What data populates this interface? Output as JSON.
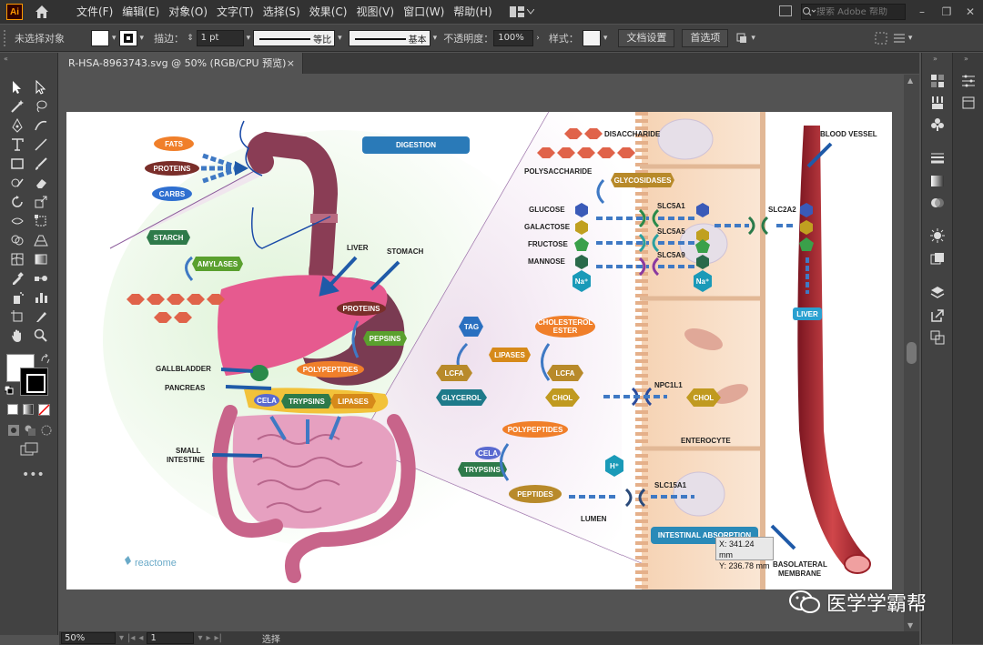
{
  "app": {
    "logo_text": "Ai",
    "menus": [
      "文件(F)",
      "编辑(E)",
      "对象(O)",
      "文字(T)",
      "选择(S)",
      "效果(C)",
      "视图(V)",
      "窗口(W)",
      "帮助(H)"
    ],
    "search_placeholder": "搜索 Adobe 帮助"
  },
  "controlbar": {
    "selection_label": "未选择对象",
    "stroke_label": "描边：",
    "stroke_weight": "1 pt",
    "stroke_profile": "等比",
    "brush": "基本",
    "opacity_label": "不透明度：",
    "opacity_value": "100%",
    "style_label": "样式：",
    "doc_setup_button": "文档设置",
    "prefs_button": "首选项"
  },
  "document": {
    "tab_title": "R-HSA-8963743.svg @ 50% (RGB/CPU 预览)",
    "close_glyph": "×"
  },
  "statusbar": {
    "zoom": "50%",
    "page": "1",
    "mode": "选择"
  },
  "tooltip": {
    "x": "X: 341.24 mm",
    "y": "Y: 236.78 mm"
  },
  "watermark": "医学学霸帮",
  "artwork": {
    "digestion_title": "DIGESTION",
    "fats": "FATS",
    "proteins": "PROTEINS",
    "carbs": "CARBS",
    "starch": "STARCH",
    "amylases": "AMYLASES",
    "liver": "LIVER",
    "stomach": "STOMACH",
    "proteins2": "PROTEINS",
    "pepsins": "PEPSINS",
    "polypeptides": "POLYPEPTIDES",
    "gallbladder": "GALLBLADDER",
    "pancreas": "PANCREAS",
    "cela": "CELA",
    "trypsins": "TRYPSINS",
    "lipases": "LIPASES",
    "small_intestine_1": "SMALL",
    "small_intestine_2": "INTESTINE",
    "reactome": "reactome",
    "disaccharide": "DISACCHARIDE",
    "polysaccharide": "POLYSACCHARIDE",
    "glycosidases": "GLYCOSIDASES",
    "glucose": "GLUCOSE",
    "galactose": "GALACTOSE",
    "fructose": "FRUCTOSE",
    "mannose": "MANNOSE",
    "na": "Na⁺",
    "slc5a1": "SLC5A1",
    "slc5a5": "SLC5A5",
    "slc5a9": "SLC5A9",
    "slc2a2": "SLC2A2",
    "blood_vessel": "BLOOD VESSEL",
    "liver2": "LIVER",
    "tag": "TAG",
    "cholesterol_1": "CHOLESTEROL",
    "cholesterol_2": "ESTER",
    "lipases2": "LIPASES",
    "lcfa": "LCFA",
    "glycerol": "GLYCEROL",
    "chol": "CHOL",
    "npc1l1": "NPC1L1",
    "enterocyte": "ENTEROCYTE",
    "polypeptides2": "POLYPEPTIDES",
    "cela2": "CELA",
    "trypsins2": "TRYPSINS",
    "h": "H⁺",
    "slc15a1": "SLC15A1",
    "peptides": "PEPTIDES",
    "lumen": "LUMEN",
    "intestinal_absorption": "INTESTINAL ABSORPTION",
    "basolateral_1": "BASOLATERAL",
    "basolateral_2": "MEMBRANE"
  }
}
